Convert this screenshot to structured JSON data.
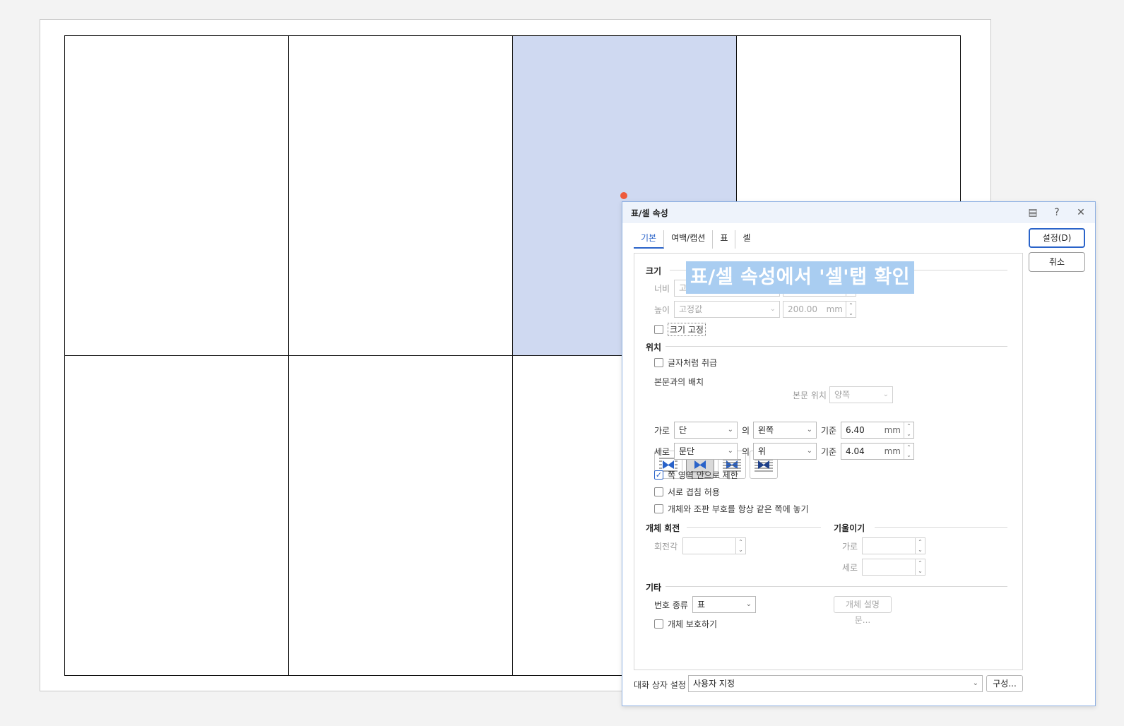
{
  "dialog": {
    "title": "표/셀 속성",
    "tabs": [
      "기본",
      "여백/캡션",
      "표",
      "셀"
    ],
    "ok_label": "설정(D)",
    "cancel_label": "취소",
    "size": {
      "section": "크기",
      "width_label": "너비",
      "width_mode": "고정값",
      "height_label": "높이",
      "height_mode": "고정값",
      "height_value": "200.00",
      "unit": "mm",
      "fix_size_label": "크기 고정"
    },
    "position": {
      "section": "위치",
      "treat_as_char_label": "글자처럼 취급",
      "arrange_label": "본문과의 배치",
      "text_position_label": "본문 위치",
      "text_position_value": "양쪽",
      "horiz_label": "가로",
      "horiz_ref": "단",
      "of_label": "의",
      "horiz_side": "왼쪽",
      "base_label": "기준",
      "horiz_value": "6.40",
      "vert_label": "세로",
      "vert_ref": "문단",
      "vert_side": "위",
      "vert_value": "4.04",
      "unit": "mm",
      "restrict_label": "쪽 영역 안으로 제한",
      "overlap_label": "서로 겹침 허용",
      "same_page_label": "개체와 조판 부호를 항상 같은 쪽에 놓기"
    },
    "rotation": {
      "section": "개체 회전",
      "angle_label": "회전각"
    },
    "skew": {
      "section": "기울이기",
      "horiz_label": "가로",
      "vert_label": "세로"
    },
    "etc": {
      "section": "기타",
      "number_type_label": "번호 종류",
      "number_type_value": "표",
      "description_button": "개체 설명문...",
      "protect_label": "개체 보호하기"
    },
    "footer": {
      "settings_label": "대화 상자 설정",
      "settings_value": "사용자 지정",
      "config_button": "구성..."
    }
  },
  "overlay_caption": "표/셀 속성에서 '셀'탭 확인",
  "colors": {
    "selected_cell": "#cfd9f1",
    "accent": "#2a63c9",
    "marker": "#ee5a3c",
    "caption_bg": "#a9cdf1"
  }
}
